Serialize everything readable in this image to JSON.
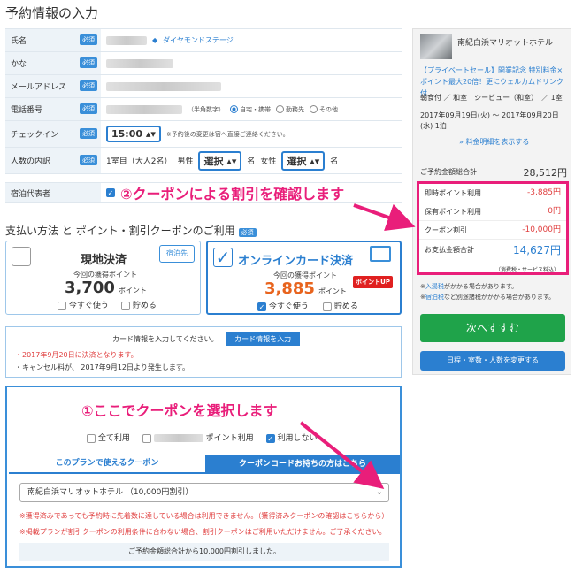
{
  "page": {
    "title": "予約情報の入力"
  },
  "required": "必須",
  "form": {
    "name_label": "氏名",
    "diamond": "ダイヤモンドステージ",
    "kana_label": "かな",
    "email_label": "メールアドレス",
    "phone_label": "電話番号",
    "phone_note": "（半角数字）",
    "phone_types": [
      "自宅・携帯",
      "勤務先",
      "その他"
    ],
    "checkin_label": "チェックイン",
    "checkin_time": "15:00",
    "checkin_note": "※予約後の変更は宿へ直接ご連絡ください。",
    "people_label": "人数の内訳",
    "room_text": "1室目（大人2名）",
    "male": "男性",
    "female": "女性",
    "select": "選択",
    "unit": "名",
    "rep_label": "宿泊代表者"
  },
  "annotations": {
    "step2": "②クーポンによる割引を確認します",
    "step1": "①ここでクーポンを選択します"
  },
  "payment": {
    "title": "支払い方法 と ポイント・割引クーポンのご利用",
    "onsite": {
      "title": "現地決済",
      "shop_icon": "宿泊先",
      "points_label": "今回の獲得ポイント",
      "points": "3,700",
      "unit": "ポイント",
      "use_now": "今すぐ使う",
      "save": "貯める"
    },
    "online": {
      "title": "オンラインカード決済",
      "points_label": "今回の獲得ポイント",
      "points": "3,885",
      "unit": "ポイント",
      "badge": "ポイントUP",
      "use_now": "今すぐ使う",
      "save": "貯める"
    }
  },
  "card": {
    "prompt": "カード情報を入力してください。",
    "button": "カード情報を入力",
    "line1": "・2017年9月20日に決済となります。",
    "line2": "・キャンセル料が、 2017年9月12日より発生します。"
  },
  "coupon": {
    "opt_all": "全て利用",
    "opt_point": "ポイント利用",
    "opt_none": "利用しない",
    "tab_plan": "このプランで使えるクーポン",
    "tab_code": "クーポンコードお持ちの方はこちら",
    "selected": "南紀白浜マリオットホテル （10,000円割引）",
    "note1": "※獲得済みであっても予約時に先着数に達している場合は利用できません。（獲得済みクーポンの確認はこちらから）",
    "note2": "※掲載プランが割引クーポンの利用条件に合わない場合、割引クーポンはご利用いただけません。ご了承ください。",
    "message": "ご予約金額総合計から10,000円割引しました。"
  },
  "sidebar": {
    "hotel": "南紀白浜マリオットホテル",
    "plan": "【プライベートセール】開業記念 特別料金×ポイント最大20倍！更にウェルカムドリンク付",
    "meal": "朝食付 ／ 和室　シービュー（和室）　／ 1室",
    "dates": "2017年09月19日(火) 〜 2017年09月20日(水) 1泊",
    "detail_link": "» 料金明細を表示する",
    "total_label": "ご予約金額総合計",
    "total": "28,512円",
    "rows": [
      {
        "label": "即時ポイント利用",
        "value": "-3,885円"
      },
      {
        "label": "保有ポイント利用",
        "value": "0円"
      },
      {
        "label": "クーポン割引",
        "value": "-10,000円"
      },
      {
        "label": "お支払金額合計",
        "value": "14,627円"
      }
    ],
    "tax": "（消費税・サービス料込）",
    "note1_pre": "※",
    "note1_link": "入湯税",
    "note1_post": "がかかる場合があります。",
    "note2_pre": "※",
    "note2_link": "宿泊税",
    "note2_post": "など別途諸税がかかる場合があります。",
    "next": "次へすすむ",
    "change": "日程・室数・人数を変更する"
  }
}
